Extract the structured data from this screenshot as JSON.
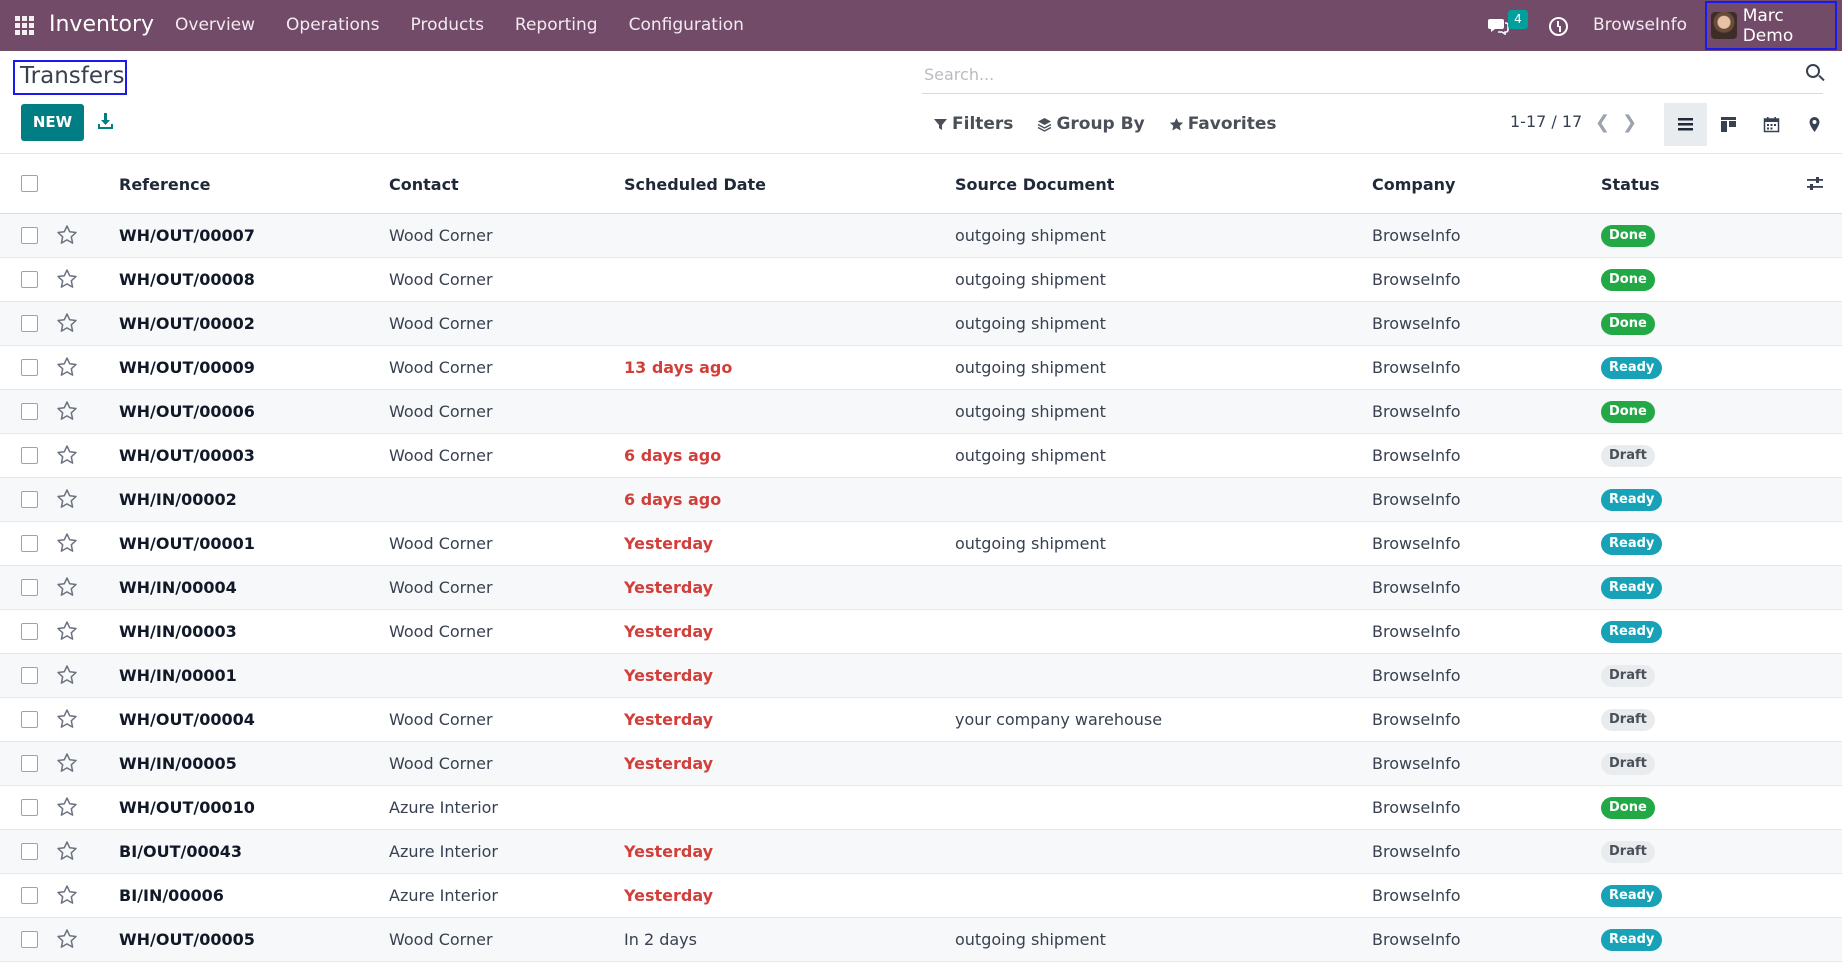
{
  "navbar": {
    "app_name": "Inventory",
    "menu": [
      "Overview",
      "Operations",
      "Products",
      "Reporting",
      "Configuration"
    ],
    "chat_count": "4",
    "company": "BrowseInfo",
    "user": "Marc Demo",
    "color": "#714b67"
  },
  "control": {
    "title": "Transfers",
    "search_placeholder": "Search...",
    "new_label": "NEW",
    "filters_label": "Filters",
    "groupby_label": "Group By",
    "favorites_label": "Favorites",
    "pager": "1-17 / 17",
    "views": [
      "list-icon",
      "kanban-icon",
      "calendar-icon",
      "map-pin-icon"
    ]
  },
  "table": {
    "headers": {
      "reference": "Reference",
      "contact": "Contact",
      "scheduled_date": "Scheduled Date",
      "source_document": "Source Document",
      "company": "Company",
      "status": "Status"
    },
    "rows": [
      {
        "ref": "WH/OUT/00007",
        "contact": "Wood Corner",
        "date": "",
        "overdue": false,
        "source": "outgoing shipment",
        "company": "BrowseInfo",
        "status": "Done"
      },
      {
        "ref": "WH/OUT/00008",
        "contact": "Wood Corner",
        "date": "",
        "overdue": false,
        "source": "outgoing shipment",
        "company": "BrowseInfo",
        "status": "Done"
      },
      {
        "ref": "WH/OUT/00002",
        "contact": "Wood Corner",
        "date": "",
        "overdue": false,
        "source": "outgoing shipment",
        "company": "BrowseInfo",
        "status": "Done"
      },
      {
        "ref": "WH/OUT/00009",
        "contact": "Wood Corner",
        "date": "13 days ago",
        "overdue": true,
        "source": "outgoing shipment",
        "company": "BrowseInfo",
        "status": "Ready"
      },
      {
        "ref": "WH/OUT/00006",
        "contact": "Wood Corner",
        "date": "",
        "overdue": false,
        "source": "outgoing shipment",
        "company": "BrowseInfo",
        "status": "Done"
      },
      {
        "ref": "WH/OUT/00003",
        "contact": "Wood Corner",
        "date": "6 days ago",
        "overdue": true,
        "source": "outgoing shipment",
        "company": "BrowseInfo",
        "status": "Draft"
      },
      {
        "ref": "WH/IN/00002",
        "contact": "",
        "date": "6 days ago",
        "overdue": true,
        "source": "",
        "company": "BrowseInfo",
        "status": "Ready"
      },
      {
        "ref": "WH/OUT/00001",
        "contact": "Wood Corner",
        "date": "Yesterday",
        "overdue": true,
        "source": "outgoing shipment",
        "company": "BrowseInfo",
        "status": "Ready"
      },
      {
        "ref": "WH/IN/00004",
        "contact": "Wood Corner",
        "date": "Yesterday",
        "overdue": true,
        "source": "",
        "company": "BrowseInfo",
        "status": "Ready"
      },
      {
        "ref": "WH/IN/00003",
        "contact": "Wood Corner",
        "date": "Yesterday",
        "overdue": true,
        "source": "",
        "company": "BrowseInfo",
        "status": "Ready"
      },
      {
        "ref": "WH/IN/00001",
        "contact": "",
        "date": "Yesterday",
        "overdue": true,
        "source": "",
        "company": "BrowseInfo",
        "status": "Draft"
      },
      {
        "ref": "WH/OUT/00004",
        "contact": "Wood Corner",
        "date": "Yesterday",
        "overdue": true,
        "source": "your company warehouse",
        "company": "BrowseInfo",
        "status": "Draft"
      },
      {
        "ref": "WH/IN/00005",
        "contact": "Wood Corner",
        "date": "Yesterday",
        "overdue": true,
        "source": "",
        "company": "BrowseInfo",
        "status": "Draft"
      },
      {
        "ref": "WH/OUT/00010",
        "contact": "Azure Interior",
        "date": "",
        "overdue": false,
        "source": "",
        "company": "BrowseInfo",
        "status": "Done"
      },
      {
        "ref": "BI/OUT/00043",
        "contact": "Azure Interior",
        "date": "Yesterday",
        "overdue": true,
        "source": "",
        "company": "BrowseInfo",
        "status": "Draft"
      },
      {
        "ref": "BI/IN/00006",
        "contact": "Azure Interior",
        "date": "Yesterday",
        "overdue": true,
        "source": "",
        "company": "BrowseInfo",
        "status": "Ready"
      },
      {
        "ref": "WH/OUT/00005",
        "contact": "Wood Corner",
        "date": "In 2 days",
        "overdue": false,
        "source": "outgoing shipment",
        "company": "BrowseInfo",
        "status": "Ready"
      }
    ]
  },
  "colors": {
    "primary": "#017e84",
    "overdue": "#d23f3a",
    "done": "#22a946",
    "ready": "#17a2b8",
    "draft": "#e9ecef"
  }
}
